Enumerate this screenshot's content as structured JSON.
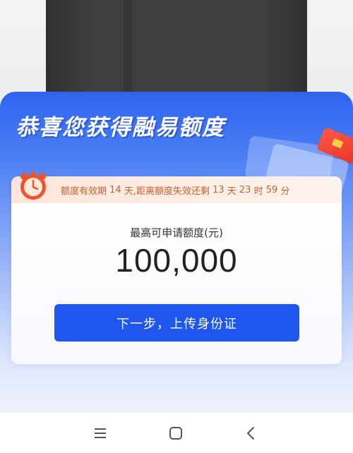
{
  "panel": {
    "title": "恭喜您获得融易额度"
  },
  "validity": {
    "prefix": "额度有效期 ",
    "days_valid": "14",
    "middle": " 天,距离额度失效还剩 ",
    "days_left": "13",
    "unit_days": " 天 ",
    "hours_left": "23",
    "unit_hours": " 时 ",
    "minutes_left": "59",
    "unit_minutes": " 分"
  },
  "amount": {
    "label": "最高可申请额度(元)",
    "value": "100,000"
  },
  "actions": {
    "next_label": "下一步，上传身份证"
  },
  "navbar": {
    "icons": [
      "menu-icon",
      "home-square-icon",
      "back-icon"
    ]
  },
  "colors": {
    "accent": "#1f57ee",
    "panel_top": "#2f64f0",
    "validity_text": "#c9622f"
  }
}
